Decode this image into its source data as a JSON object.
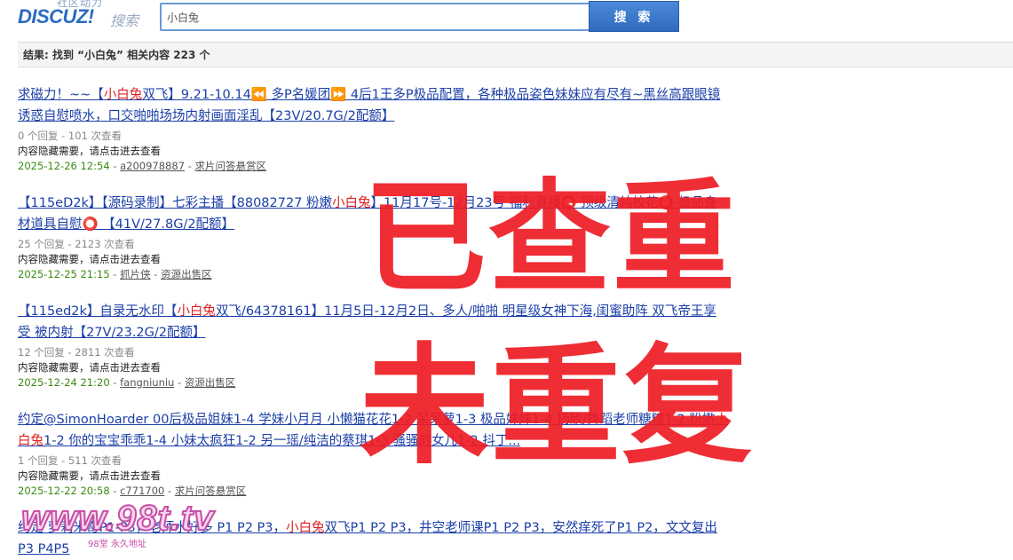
{
  "header": {
    "logo_tag": "社区动力",
    "logo_brand": "DISCUZ!",
    "logo_sub": "搜索",
    "search_value": "小白兔",
    "search_button": "搜 索"
  },
  "result_summary": "结果: 找到 “小白兔” 相关内容 223 个",
  "results": [
    {
      "title_pre": "求磁力！~~【",
      "title_hl": "小白兔",
      "title_post": "双飞】9.21-10.14⏪ 多P名媛团⏩ 4后1王多P极品配置，各种极品姿色妹妹应有尽有~黑丝高跟眼镜诱惑自慰喷水，口交啪啪场场内射画面淫乱【23V/20.7G/2配额】",
      "stats": "0 个回复 - 101 次查看",
      "note": "内容隐藏需要，请点击进去查看",
      "date": "2025-12-26 12:54",
      "author": "a200978887",
      "forum": "求片问答悬赏区"
    },
    {
      "title_pre": "【115eD2k】【源码录制】七彩主播【88082727  粉嫩",
      "title_hl": "小白兔",
      "title_post": "】11月17号-12月23号 福利直播⭕ 顶级清纯校花⭕ 极品身材道具自慰⭕ 【41V/27.8G/2配额】",
      "stats": "25 个回复 - 2123 次查看",
      "note": "内容隐藏需要，请点击进去查看",
      "date": "2025-12-25 21:15",
      "author": "抓片侠",
      "forum": "资源出售区"
    },
    {
      "title_pre": "【115ed2k】自录无水印【",
      "title_hl": "小白兔",
      "title_post": "双飞/64378161】11月5日-12月2日、多人/啪啪 明星级女神下海,闺蜜助阵 双飞帝王享受 被内射【27V/23.2G/2配额】",
      "stats": "12 个回复 - 2811 次查看",
      "note": "内容隐藏需要，请点击进去查看",
      "date": "2025-12-24 21:20",
      "author": "fangniuniu",
      "forum": "资源出售区"
    },
    {
      "title_pre": "约定@SimonHoarder 00后极品姐妹1-4 学妹小月月 小懒猫花花1-2 呆呆萝1-3 极品妹妹1-4 杨欣/舞蹈老师糖糖1-2 粉嫩",
      "title_hl": "小白兔",
      "title_post": "1-2 你的宝宝乖乖1-4 小妹太疯狂1-2 另一瑶/纯洁的蔡琪1-3 骚骚的女儿1-2 抖丁...",
      "stats": "1 个回复 - 511 次查看",
      "note": "内容隐藏需要，请点击进去查看",
      "date": "2025-12-22 20:58",
      "author": "c771700",
      "forum": "求片问答悬赏区"
    },
    {
      "title_pre": "约定 萝莉米奇P1-P3，老师水好多 P1 P2 P3，",
      "title_hl": "小白兔",
      "title_post": "双飞P1 P2 P3，井空老师课P1 P2 P3，安然痒死了P1 P2，文文复出P3 P4P5"
    }
  ],
  "stamps": {
    "top": "已查重",
    "bottom": "未重复"
  },
  "watermark": {
    "main": "www.98t.tv",
    "sub": "98堂 永久地址"
  },
  "colors": {
    "link": "#1b3fa8",
    "highlight": "#e02020",
    "date": "#3a8a10",
    "stamp": "#ee1c24",
    "button": "#2f6ac0"
  }
}
